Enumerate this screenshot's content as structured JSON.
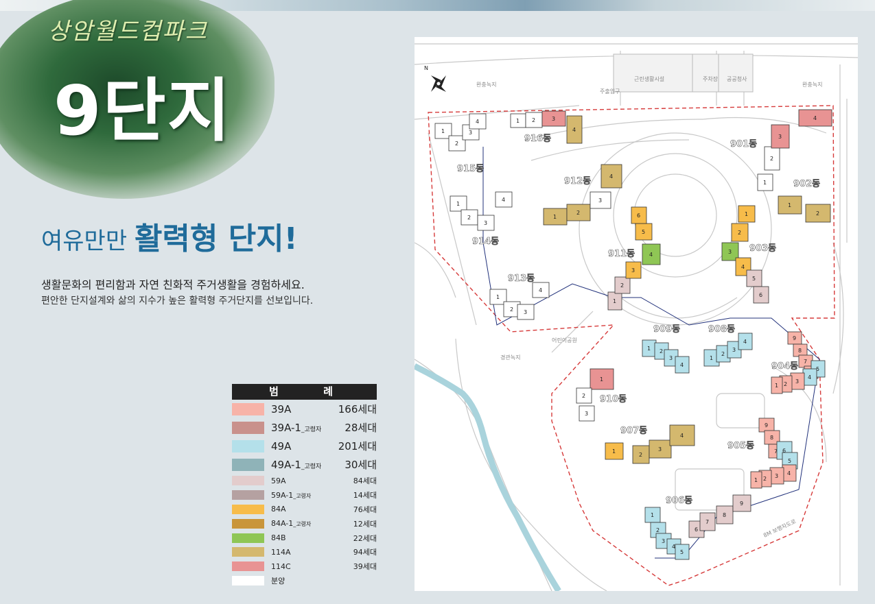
{
  "header": {
    "brand": "상암월드컵파크",
    "title": "9단지"
  },
  "slogan": {
    "part1": "여유만만 ",
    "part2": "활력형 단지!"
  },
  "description": {
    "line1": "생활문화의 편리함과 자연 친화적 주거생활을 경험하세요.",
    "line2": "편안한 단지설계와 삶의 지수가 높은 활력형 주거단지를 선보입니다."
  },
  "legend": {
    "title": "범 례",
    "items": [
      {
        "name": "39A",
        "tag": "",
        "count": "166세대",
        "color": "#f7b3a8"
      },
      {
        "name": "39A-1",
        "tag": "_고령자",
        "count": "28세대",
        "color": "#c9918c"
      },
      {
        "name": "49A",
        "tag": "",
        "count": "201세대",
        "color": "#b4e0ea"
      },
      {
        "name": "49A-1",
        "tag": "_고령자",
        "count": "30세대",
        "color": "#8fb3b8"
      },
      {
        "name": "59A",
        "tag": "",
        "count": "84세대",
        "color": "#e3cccc"
      },
      {
        "name": "59A-1",
        "tag": "_고령자",
        "count": "14세대",
        "color": "#b5a1a1"
      },
      {
        "name": "84A",
        "tag": "",
        "count": "76세대",
        "color": "#f7bc4a"
      },
      {
        "name": "84A-1",
        "tag": "_고령자",
        "count": "12세대",
        "color": "#c9953a"
      },
      {
        "name": "84B",
        "tag": "",
        "count": "22세대",
        "color": "#8fc655"
      },
      {
        "name": "114A",
        "tag": "",
        "count": "94세대",
        "color": "#d4b86e"
      },
      {
        "name": "114C",
        "tag": "",
        "count": "39세대",
        "color": "#e89393"
      },
      {
        "name": "분양",
        "tag": "",
        "count": "",
        "color": "#ffffff"
      }
    ]
  },
  "map": {
    "north": "N",
    "places": {
      "green1": "완충녹지",
      "green2": "완충녹지",
      "facility": "근린생활시설",
      "parking": "주차장",
      "office": "공공청사",
      "road_top": "주출입구",
      "park": "어린이공원",
      "green3": "경관녹지",
      "road_bottom": "8M 보행자도로"
    },
    "buildings": [
      {
        "id": "b901",
        "label": "901동"
      },
      {
        "id": "b902",
        "label": "902동"
      },
      {
        "id": "b903",
        "label": "903동"
      },
      {
        "id": "b904",
        "label": "904동"
      },
      {
        "id": "b905",
        "label": "905동"
      },
      {
        "id": "b906",
        "label": "906동"
      },
      {
        "id": "b907",
        "label": "907동"
      },
      {
        "id": "b908",
        "label": "908동"
      },
      {
        "id": "b909",
        "label": "909동"
      },
      {
        "id": "b910",
        "label": "910동"
      },
      {
        "id": "b911",
        "label": "911동"
      },
      {
        "id": "b912",
        "label": "912동"
      },
      {
        "id": "b913",
        "label": "913동"
      },
      {
        "id": "b914",
        "label": "914동"
      },
      {
        "id": "b915",
        "label": "915동"
      },
      {
        "id": "b916",
        "label": "916동"
      }
    ],
    "unit_numbers": [
      "1",
      "2",
      "3",
      "4",
      "5",
      "6",
      "7",
      "8",
      "9"
    ]
  }
}
